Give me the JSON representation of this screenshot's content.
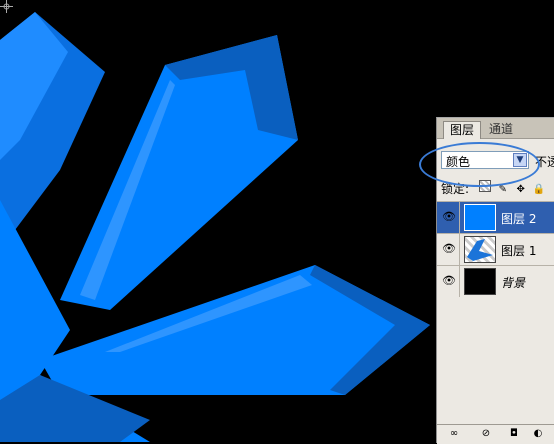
{
  "colors": {
    "artwork": "#0080ff",
    "highlight": "#0d6fd6",
    "shadow": "#0a5fbf",
    "selected_row": "#2f5faf"
  },
  "panel": {
    "tabs": [
      {
        "label": "图层"
      },
      {
        "label": "通道"
      }
    ],
    "blend_mode": "颜色",
    "opacity_label": "不透",
    "lock_label": "锁定:",
    "lock_icons": [
      "lock-transparent-icon",
      "lock-brush-icon",
      "lock-move-icon",
      "lock-all-icon"
    ],
    "layers": [
      {
        "name": "图层 2",
        "selected": true,
        "visible": true,
        "thumb": "blue-fill"
      },
      {
        "name": "图层 1",
        "selected": false,
        "visible": true,
        "thumb": "star-image"
      },
      {
        "name": "背景",
        "selected": false,
        "visible": true,
        "thumb": "black-fill"
      }
    ],
    "bottom_icons": [
      "link-icon",
      "layer-style-icon",
      "mask-icon",
      "adjustment-icon"
    ]
  }
}
